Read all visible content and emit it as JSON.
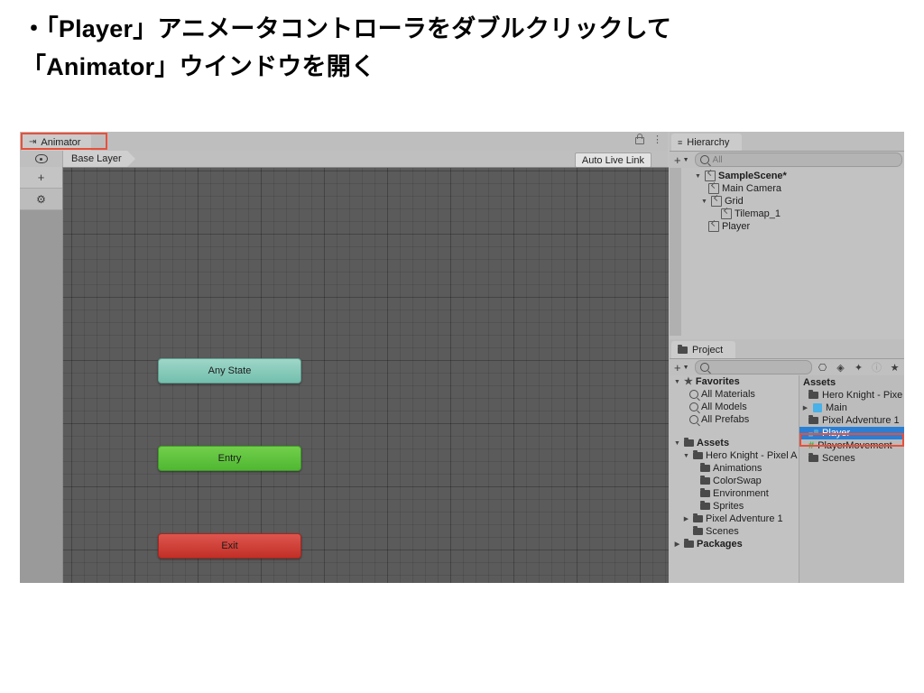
{
  "slide": {
    "heading": "・「Player」アニメータコントローラをダブルクリックして\n「Animator」ウインドウを開く"
  },
  "animator": {
    "tab_label": "Animator",
    "tab_icon": "animator-icon",
    "highlight_color": "#e8503a",
    "lock_icon": "lock-icon",
    "menu_icon": "kebab-menu-icon",
    "eye_icon": "visibility-eye-icon",
    "breadcrumb_label": "Base Layer",
    "auto_live_link_label": "Auto Live Link",
    "layers_add_label": "+",
    "layers_settings_icon": "gear-icon",
    "nodes": [
      {
        "label": "Any State",
        "color": "#86cabb"
      },
      {
        "label": "Entry",
        "color": "#5fc33e"
      },
      {
        "label": "Exit",
        "color": "#d0423a"
      }
    ]
  },
  "hierarchy": {
    "tab_label": "Hierarchy",
    "tab_icon": "hierarchy-list-icon",
    "add_label": "+",
    "search_placeholder": "All",
    "items": [
      {
        "label": "SampleScene*",
        "indent": 0,
        "twisty": "down",
        "icon": "scene-icon",
        "bold": true
      },
      {
        "label": "Main Camera",
        "indent": 1,
        "twisty": "none",
        "icon": "gameobject-icon",
        "bold": false
      },
      {
        "label": "Grid",
        "indent": 1,
        "twisty": "down",
        "icon": "gameobject-icon",
        "bold": false
      },
      {
        "label": "Tilemap_1",
        "indent": 2,
        "twisty": "none",
        "icon": "gameobject-icon",
        "bold": false
      },
      {
        "label": "Player",
        "indent": 1,
        "twisty": "none",
        "icon": "gameobject-icon",
        "bold": false
      }
    ]
  },
  "project": {
    "tab_label": "Project",
    "tab_icon": "folder-icon",
    "add_label": "+",
    "search_placeholder": "",
    "toolbar_icons": [
      "search-in-scene-icon",
      "object-picker-icon",
      "label-tag-icon",
      "info-icon",
      "favorite-star-icon"
    ],
    "tree": [
      {
        "label": "Favorites",
        "indent": 0,
        "twisty": "down",
        "icon": "star-icon",
        "bold": true
      },
      {
        "label": "All Materials",
        "indent": 1,
        "twisty": "none",
        "icon": "search-icon",
        "bold": false
      },
      {
        "label": "All Models",
        "indent": 1,
        "twisty": "none",
        "icon": "search-icon",
        "bold": false
      },
      {
        "label": "All Prefabs",
        "indent": 1,
        "twisty": "none",
        "icon": "search-icon",
        "bold": false
      },
      {
        "label": "",
        "indent": 0,
        "twisty": "none",
        "icon": "none",
        "bold": false
      },
      {
        "label": "Assets",
        "indent": 0,
        "twisty": "down",
        "icon": "folder-open-icon",
        "bold": true
      },
      {
        "label": "Hero Knight - Pixel A",
        "indent": 1,
        "twisty": "down",
        "icon": "folder-open-icon",
        "bold": false
      },
      {
        "label": "Animations",
        "indent": 2,
        "twisty": "none",
        "icon": "folder-icon",
        "bold": false
      },
      {
        "label": "ColorSwap",
        "indent": 2,
        "twisty": "none",
        "icon": "folder-icon",
        "bold": false
      },
      {
        "label": "Environment",
        "indent": 2,
        "twisty": "none",
        "icon": "folder-icon",
        "bold": false
      },
      {
        "label": "Sprites",
        "indent": 2,
        "twisty": "none",
        "icon": "folder-icon",
        "bold": false
      },
      {
        "label": "Pixel Adventure 1",
        "indent": 1,
        "twisty": "right",
        "icon": "folder-icon",
        "bold": false
      },
      {
        "label": "Scenes",
        "indent": 1,
        "twisty": "none",
        "icon": "folder-icon",
        "bold": false
      },
      {
        "label": "Packages",
        "indent": 0,
        "twisty": "right",
        "icon": "folder-icon",
        "bold": true
      }
    ],
    "assets_header": "Assets",
    "assets": [
      {
        "label": "Hero Knight - Pixe",
        "icon": "folder-icon",
        "twisty": "none",
        "selected": false
      },
      {
        "label": "Main",
        "icon": "prefab-icon",
        "twisty": "right",
        "selected": false
      },
      {
        "label": "Pixel Adventure 1",
        "icon": "folder-icon",
        "twisty": "none",
        "selected": false
      },
      {
        "label": "Player",
        "icon": "animator-controller-icon",
        "twisty": "none",
        "selected": true
      },
      {
        "label": "PlayerMovement",
        "icon": "csharp-script-icon",
        "twisty": "none",
        "selected": false
      },
      {
        "label": "Scenes",
        "icon": "folder-icon",
        "twisty": "none",
        "selected": false
      }
    ],
    "selection_highlight_color": "#e8503a",
    "selection_row_color": "#2a7fd4"
  }
}
